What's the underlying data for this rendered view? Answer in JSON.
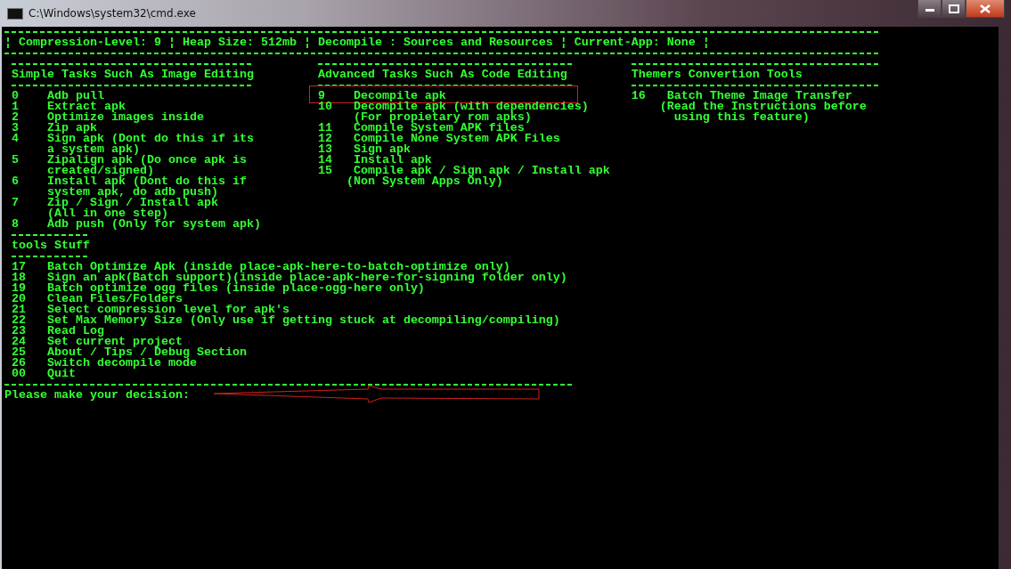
{
  "window": {
    "title": "C:\\Windows\\system32\\cmd.exe"
  },
  "status_line": "¦ Compression-Level: 9 ¦ Heap Size: 512mb ¦ Decompile : Sources and Resources ¦ Current-App: None ¦",
  "columns": [
    {
      "title": "Simple Tasks Such As Image Editing",
      "items": [
        {
          "number": "0",
          "label": "Adb pull",
          "highlighted": false
        },
        {
          "number": "1",
          "label": "Extract apk",
          "highlighted": false
        },
        {
          "number": "2",
          "label": "Optimize images inside",
          "highlighted": false
        },
        {
          "number": "3",
          "label": "Zip apk",
          "highlighted": false
        },
        {
          "number": "4",
          "label": "Sign apk (Dont do this if its",
          "highlighted": false,
          "lines": [
            {
              "kind": "wrap",
              "text": "a system apk)"
            }
          ]
        },
        {
          "number": "5",
          "label": "Zipalign apk (Do once apk is",
          "highlighted": false,
          "lines": [
            {
              "kind": "wrap",
              "text": "created/signed)"
            }
          ]
        },
        {
          "number": "6",
          "label": "Install apk (Dont do this if",
          "highlighted": false,
          "lines": [
            {
              "kind": "wrap",
              "text": "system apk, do adb push)"
            }
          ]
        },
        {
          "number": "7",
          "label": "Zip / Sign / Install apk",
          "highlighted": false,
          "lines": [
            {
              "kind": "wrap",
              "text": "(All in one step)"
            }
          ]
        },
        {
          "number": "8",
          "label": "Adb push (Only for system apk)",
          "highlighted": false
        }
      ]
    },
    {
      "title": "Advanced Tasks Such As Code Editing",
      "items": [
        {
          "number": "9",
          "label": "Decompile apk",
          "highlighted": true
        },
        {
          "number": "10",
          "label": "Decompile apk (with dependencies)",
          "highlighted": false,
          "lines": [
            {
              "kind": "wrap",
              "text": "(For propietary rom apks)"
            }
          ]
        },
        {
          "number": "11",
          "label": "Compile System APK files",
          "highlighted": false
        },
        {
          "number": "12",
          "label": "Compile None System APK Files",
          "highlighted": false
        },
        {
          "number": "13",
          "label": "Sign apk",
          "highlighted": false
        },
        {
          "number": "14",
          "label": "Install apk",
          "highlighted": false
        },
        {
          "number": "15",
          "label": "Compile apk / Sign apk / Install apk",
          "highlighted": false,
          "lines": [
            {
              "kind": "note",
              "text": "(Non System Apps Only)"
            }
          ]
        }
      ]
    },
    {
      "title": "Themers Convertion Tools",
      "items": [
        {
          "number": "16",
          "label": "Batch Theme Image Transfer",
          "highlighted": false,
          "lines": [
            {
              "kind": "note",
              "text": "(Read the Instructions before"
            },
            {
              "kind": "deep",
              "text": "using this feature)"
            }
          ]
        }
      ]
    }
  ],
  "tools": {
    "title": "tools Stuff",
    "items": [
      {
        "number": "17",
        "label": "Batch Optimize Apk (inside place-apk-here-to-batch-optimize only)"
      },
      {
        "number": "18",
        "label": "Sign an apk(Batch support)(inside place-apk-here-for-signing folder only)"
      },
      {
        "number": "19",
        "label": "Batch optimize ogg files (inside place-ogg-here only)"
      },
      {
        "number": "20",
        "label": "Clean Files/Folders"
      },
      {
        "number": "21",
        "label": "Select compression level for apk's"
      },
      {
        "number": "22",
        "label": "Set Max Memory Size (Only use if getting stuck at decompiling/compiling)"
      },
      {
        "number": "23",
        "label": "Read Log"
      },
      {
        "number": "24",
        "label": "Set current project"
      },
      {
        "number": "25",
        "label": "About / Tips / Debug Section"
      },
      {
        "number": "26",
        "label": "Switch decompile mode"
      },
      {
        "number": "00",
        "label": "Quit"
      }
    ]
  },
  "prompt": "Please make your decision:"
}
